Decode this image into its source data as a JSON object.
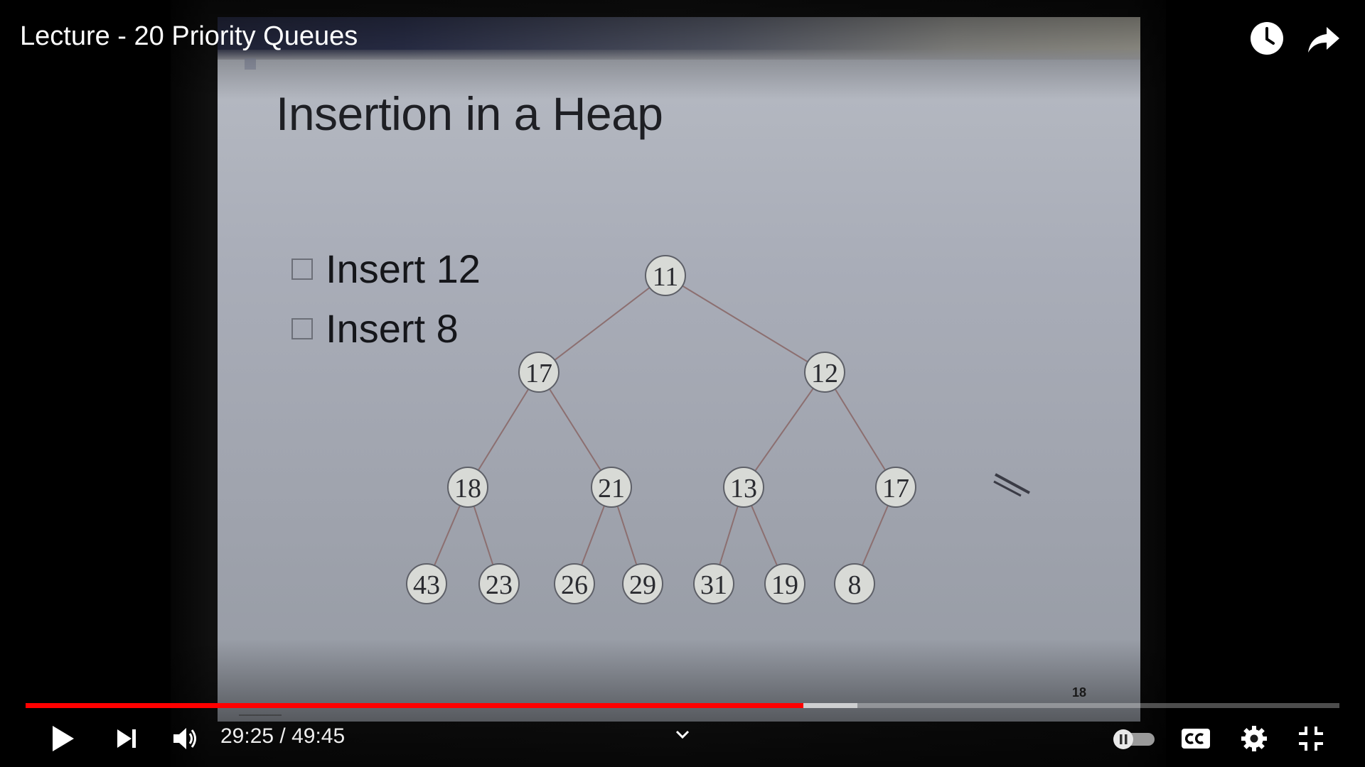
{
  "video": {
    "title": "Lecture - 20 Priority Queues",
    "progress_played": 0.592,
    "progress_buffered": 0.633
  },
  "slide": {
    "title": "Insertion in a Heap",
    "bullets": [
      "Insert 12",
      "Insert 8"
    ],
    "slide_number": "18",
    "heap_nodes": [
      "11",
      "17",
      "12",
      "18",
      "21",
      "13",
      "17",
      "43",
      "23",
      "26",
      "29",
      "31",
      "19",
      "8"
    ]
  },
  "controls": {
    "time_current": "29:25",
    "time_separator": " / ",
    "time_total": "49:45",
    "time_text": "29:25 / 49:45"
  },
  "colors": {
    "progress_played": "#ff0000",
    "progress_buffered": "#cccccc",
    "icon": "#ffffff"
  },
  "icons": {
    "play": "play-icon",
    "next": "next-icon",
    "volume": "volume-icon",
    "chevron": "chevron-down-icon",
    "autoplay": "autoplay-toggle-icon",
    "cc": "cc-icon",
    "settings": "gear-icon",
    "exit_fullscreen": "exit-fullscreen-icon",
    "watch_later": "clock-icon",
    "share": "share-icon"
  }
}
